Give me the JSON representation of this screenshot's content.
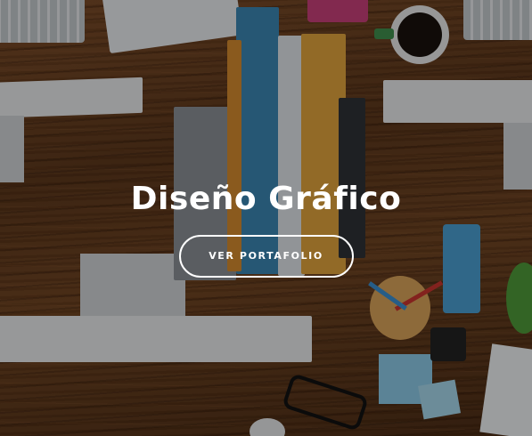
{
  "hero": {
    "title": "Diseño Gráfico",
    "button_label": "VER PORTAFOLIO"
  },
  "colors": {
    "text": "#ffffff",
    "wood": "#6b3f1e"
  }
}
